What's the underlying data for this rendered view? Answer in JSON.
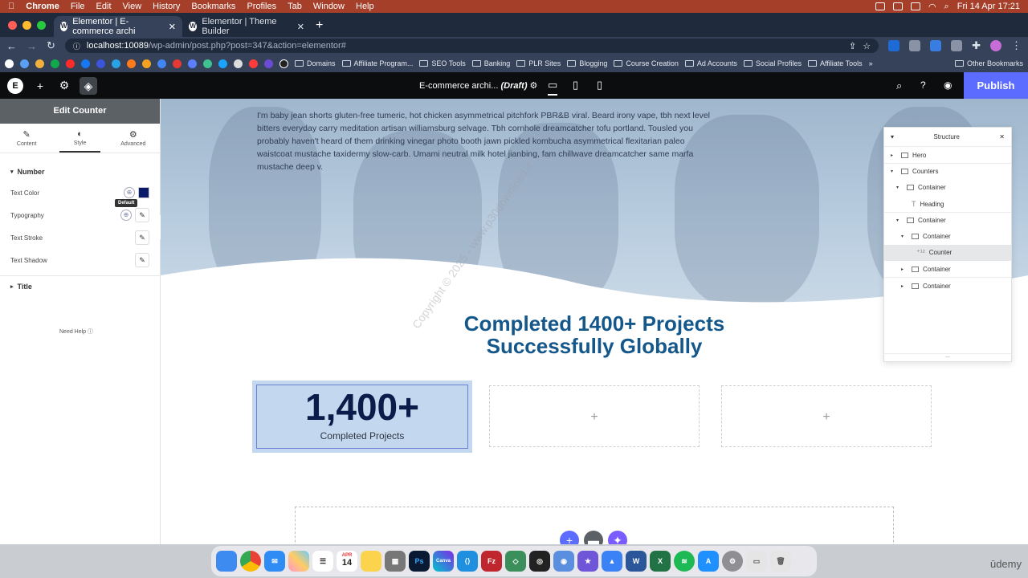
{
  "menubar": {
    "apple": "",
    "items": [
      "Chrome",
      "File",
      "Edit",
      "View",
      "History",
      "Bookmarks",
      "Profiles",
      "Tab",
      "Window",
      "Help"
    ],
    "datetime": "Fri 14 Apr  17:21"
  },
  "tabs": [
    {
      "title": "Elementor | E-commerce archi",
      "active": true
    },
    {
      "title": "Elementor | Theme Builder",
      "active": false
    }
  ],
  "address": {
    "host": "localhost:10089",
    "path": "/wp-admin/post.php?post=347&action=elementor#"
  },
  "bookmarks": {
    "folders": [
      "Domains",
      "Affiliate Program...",
      "SEO Tools",
      "Banking",
      "PLR Sites",
      "Blogging",
      "Course Creation",
      "Ad Accounts",
      "Social Profiles",
      "Affiliate Tools"
    ],
    "overflow": "»",
    "other": "Other Bookmarks"
  },
  "editor": {
    "doc_title": "E-commerce archi...",
    "doc_status": "(Draft)",
    "publish": "Publish"
  },
  "panel": {
    "header": "Edit Counter",
    "tabs": [
      "Content",
      "Style",
      "Advanced"
    ],
    "section_number": "Number",
    "controls": [
      "Text Color",
      "Typography",
      "Text Stroke",
      "Text Shadow"
    ],
    "tooltip": "Default",
    "section_title": "Title",
    "need_help": "Need Help"
  },
  "canvas": {
    "hero_text": "I'm baby jean shorts gluten-free tumeric, hot chicken asymmetrical pitchfork PBR&B viral. Beard irony vape, tbh next level bitters everyday carry meditation artisan williamsburg selvage. Tbh cornhole dreamcatcher tofu portland. Tousled you probably haven't heard of them drinking vinegar photo booth jawn pickled kombucha asymmetrical flexitarian paleo waistcoat mustache taxidermy slow-carb. Umami neutral milk hotel jianbing, fam chillwave dreamcatcher same marfa mustache deep v.",
    "heading_line1": "Completed 1400+ Projects",
    "heading_line2": "Successfully Globally",
    "counter_number": "1,400+",
    "counter_title": "Completed Projects",
    "watermark": "Copyright © 2025 - www.p30download.ir",
    "add_symbol": "+"
  },
  "structure": {
    "title": "Structure",
    "items": [
      {
        "label": "Hero",
        "depth": 0,
        "arrow": "▸",
        "icon": "box"
      },
      {
        "label": "Counters",
        "depth": 0,
        "arrow": "▾",
        "icon": "box"
      },
      {
        "label": "Container",
        "depth": 1,
        "arrow": "▾",
        "icon": "box"
      },
      {
        "label": "Heading",
        "depth": 2,
        "arrow": "",
        "icon": "T"
      },
      {
        "label": "Container",
        "depth": 1,
        "arrow": "▾",
        "icon": "box"
      },
      {
        "label": "Container",
        "depth": 2,
        "arrow": "▾",
        "icon": "box"
      },
      {
        "label": "Counter",
        "depth": 3,
        "arrow": "",
        "icon": "counter",
        "selected": true
      },
      {
        "label": "Container",
        "depth": 2,
        "arrow": "▸",
        "icon": "box"
      },
      {
        "label": "Container",
        "depth": 2,
        "arrow": "▸",
        "icon": "box"
      }
    ],
    "footer": "..."
  },
  "dock": {
    "calendar_month": "APR",
    "calendar_day": "14",
    "brand": "ūdemy"
  },
  "colors": {
    "publish": "#5b6cff",
    "heading": "#14578a",
    "counter_number": "#0c1c4a"
  }
}
